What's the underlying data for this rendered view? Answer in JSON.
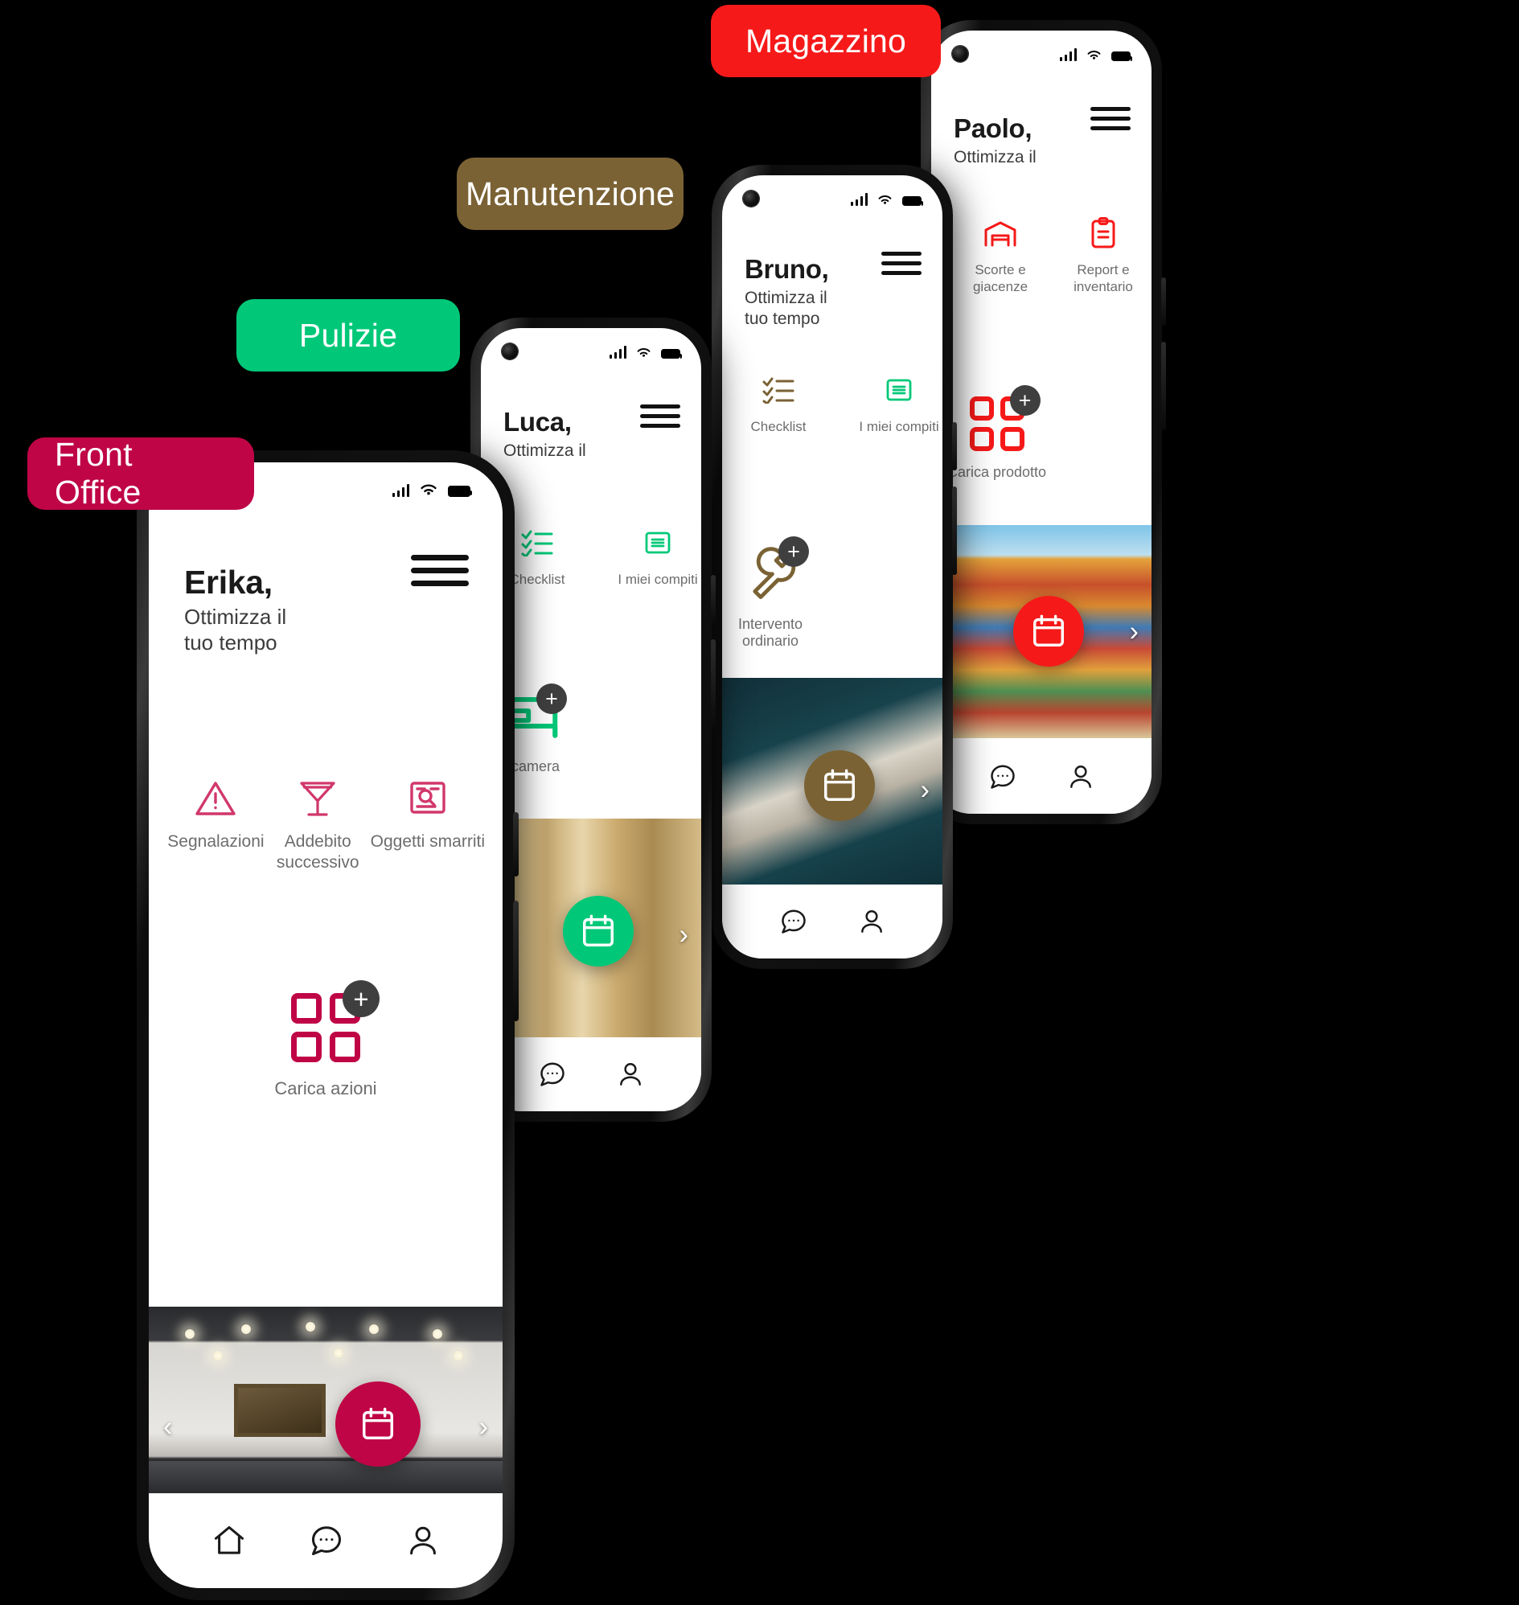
{
  "tags": [
    {
      "label": "Front Office",
      "color": "#bf0546"
    },
    {
      "label": "Pulizie",
      "color": "#00c878"
    },
    {
      "label": "Manutenzione",
      "color": "#7a6234"
    },
    {
      "label": "Magazzino",
      "color": "#f61919"
    }
  ],
  "phones": [
    {
      "id": "magazzino",
      "accent": "#f61919",
      "greeting_name": "Paolo,",
      "greeting_sub": "Ottimizza il",
      "status": {
        "signal": "signal-icon",
        "wifi": "wifi-icon",
        "battery": "battery-icon"
      },
      "menu_icon": "hamburger-menu-icon",
      "actions": [
        {
          "icon": "warehouse-icon",
          "label": "Scorte e\ngiacenze"
        },
        {
          "icon": "clipboard-icon",
          "label": "Report e\ninventario"
        }
      ],
      "carica": {
        "icon": "grid-plus-icon",
        "label": "Carica prodotto"
      },
      "hero": {
        "image": "shipping-containers-photo",
        "arrow": "chevron-right-icon"
      },
      "fab": {
        "icon": "calendar-icon"
      },
      "bottom_nav": [
        {
          "icon": "chat-bubble-icon",
          "label": ""
        },
        {
          "icon": "profile-icon",
          "label": ""
        }
      ]
    },
    {
      "id": "manutenzione",
      "accent": "#7a6234",
      "greeting_name": "Bruno,",
      "greeting_sub": "Ottimizza il\ntuo tempo",
      "status": {
        "signal": "signal-icon",
        "wifi": "wifi-icon",
        "battery": "battery-icon"
      },
      "menu_icon": "hamburger-menu-icon",
      "actions": [
        {
          "icon": "checklist-icon",
          "label": "Checklist"
        },
        {
          "icon": "document-lines-icon",
          "label": "I miei compiti"
        }
      ],
      "carica": {
        "icon": "wrench-plus-icon",
        "label": "Intervento\nordinario"
      },
      "hero": {
        "image": "network-cables-photo",
        "arrow": "chevron-right-icon"
      },
      "fab": {
        "icon": "calendar-icon"
      },
      "bottom_nav": [
        {
          "icon": "chat-bubble-icon",
          "label": ""
        },
        {
          "icon": "profile-icon",
          "label": ""
        }
      ]
    },
    {
      "id": "pulizie",
      "accent": "#00c878",
      "greeting_name": "Luca,",
      "greeting_sub": "Ottimizza il",
      "status": {
        "signal": "signal-icon",
        "wifi": "wifi-icon",
        "battery": "battery-icon"
      },
      "menu_icon": "hamburger-menu-icon",
      "actions": [
        {
          "icon": "checklist-icon",
          "label": "Checklist"
        },
        {
          "icon": "document-lines-icon",
          "label": "I miei compiti"
        }
      ],
      "carica": {
        "icon": "bed-plus-icon",
        "label": "In camera"
      },
      "hero": {
        "image": "gold-interior-photo",
        "arrow": "chevron-right-icon"
      },
      "fab": {
        "icon": "calendar-icon"
      },
      "bottom_nav": [
        {
          "icon": "chat-bubble-icon",
          "label": ""
        },
        {
          "icon": "profile-icon",
          "label": ""
        }
      ]
    },
    {
      "id": "front-office",
      "accent": "#bf0546",
      "greeting_name": "Erika,",
      "greeting_sub": "Ottimizza il\ntuo tempo",
      "status": {
        "signal": "signal-icon",
        "wifi": "wifi-icon",
        "battery": "battery-icon"
      },
      "menu_icon": "hamburger-menu-icon",
      "actions": [
        {
          "icon": "warning-triangle-icon",
          "label": "Segnalazioni"
        },
        {
          "icon": "cocktail-glass-icon",
          "label": "Addebito\nsuccessivo"
        },
        {
          "icon": "lost-found-icon",
          "label": "Oggetti smarriti"
        }
      ],
      "carica": {
        "icon": "grid-plus-icon",
        "label": "Carica azioni"
      },
      "hero": {
        "image": "hotel-lobby-photo",
        "arrow_left": "chevron-left-icon",
        "arrow_right": "chevron-right-icon"
      },
      "fab": {
        "icon": "calendar-icon"
      },
      "bottom_nav": [
        {
          "icon": "home-icon",
          "label": ""
        },
        {
          "icon": "chat-bubble-icon",
          "label": ""
        },
        {
          "icon": "profile-icon",
          "label": ""
        }
      ]
    }
  ],
  "plus_badge": "+"
}
